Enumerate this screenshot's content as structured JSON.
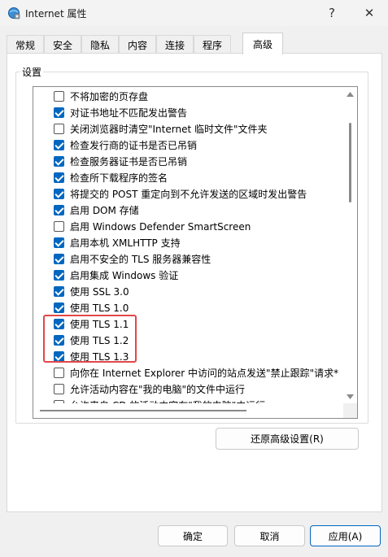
{
  "window": {
    "title": "Internet 属性",
    "help_label": "?",
    "close_label": "✕"
  },
  "tabs": [
    {
      "label": "常规"
    },
    {
      "label": "安全"
    },
    {
      "label": "隐私"
    },
    {
      "label": "内容"
    },
    {
      "label": "连接"
    },
    {
      "label": "程序"
    },
    {
      "label": "高级",
      "active": true
    }
  ],
  "settings": {
    "group_label": "设置",
    "items": [
      {
        "label": "不将加密的页存盘",
        "checked": false
      },
      {
        "label": "对证书地址不匹配发出警告",
        "checked": true
      },
      {
        "label": "关闭浏览器时清空\"Internet 临时文件\"文件夹",
        "checked": false
      },
      {
        "label": "检查发行商的证书是否已吊销",
        "checked": true
      },
      {
        "label": "检查服务器证书是否已吊销",
        "checked": true
      },
      {
        "label": "检查所下载程序的签名",
        "checked": true
      },
      {
        "label": "将提交的 POST 重定向到不允许发送的区域时发出警告",
        "checked": true
      },
      {
        "label": "启用 DOM 存储",
        "checked": true
      },
      {
        "label": "启用 Windows Defender SmartScreen",
        "checked": false
      },
      {
        "label": "启用本机 XMLHTTP 支持",
        "checked": true
      },
      {
        "label": "启用不安全的 TLS 服务器兼容性",
        "checked": true
      },
      {
        "label": "启用集成 Windows 验证",
        "checked": true
      },
      {
        "label": "使用 SSL 3.0",
        "checked": true
      },
      {
        "label": "使用 TLS 1.0",
        "checked": true
      },
      {
        "label": "使用 TLS 1.1",
        "checked": true
      },
      {
        "label": "使用 TLS 1.2",
        "checked": true
      },
      {
        "label": "使用 TLS 1.3",
        "checked": true
      },
      {
        "label": "向你在 Internet Explorer 中访问的站点发送\"禁止跟踪\"请求*",
        "checked": false
      },
      {
        "label": "允许活动内容在\"我的电脑\"的文件中运行",
        "checked": false
      },
      {
        "label": "允许来自 CD 的活动内容在\"我的电脑\"中运行",
        "checked": false
      }
    ]
  },
  "restore_button": "还原高级设置(R)",
  "footer": {
    "ok": "确定",
    "cancel": "取消",
    "apply": "应用(A)"
  },
  "colors": {
    "accent": "#0067c0",
    "highlight_border": "#e2474a"
  }
}
